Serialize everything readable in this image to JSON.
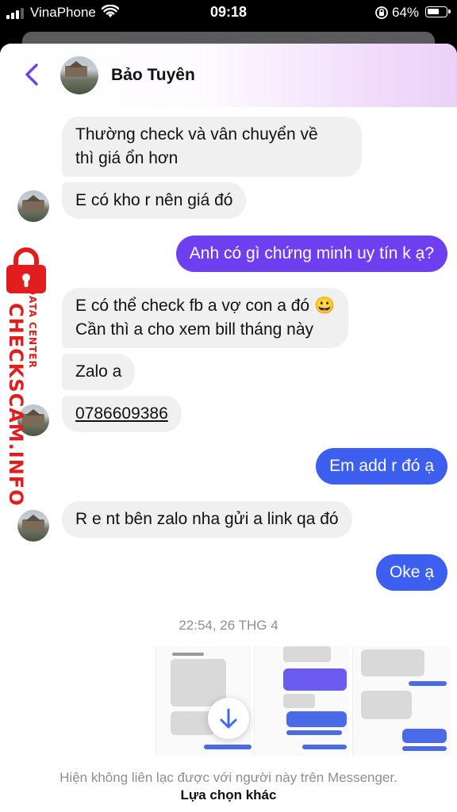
{
  "status_bar": {
    "carrier": "VinaPhone",
    "time": "09:18",
    "battery": "64%",
    "battery_level": 0.64
  },
  "header": {
    "contact_name": "Bảo Tuyên"
  },
  "messages": [
    {
      "direction": "in",
      "text_lines": [
        "Thường check và vân chuyển về",
        "thì giá ổn hơn"
      ]
    },
    {
      "direction": "in",
      "text": "E có kho r nên giá đó"
    },
    {
      "direction": "out",
      "text": "Anh có gì chứng minh uy tín k ạ?"
    },
    {
      "direction": "in",
      "text_lines": [
        "E có thể check fb a vợ con a đó 😀",
        "Cần thì a cho xem bill tháng này"
      ]
    },
    {
      "direction": "in",
      "text": "Zalo a"
    },
    {
      "direction": "in",
      "text": "0786609386",
      "link": true
    },
    {
      "direction": "out",
      "text": "Em add r đó ạ"
    },
    {
      "direction": "in",
      "text": "R e nt bên zalo nha gửi a link qa đó"
    },
    {
      "direction": "out",
      "text": "Oke ạ"
    }
  ],
  "timestamp": "22:54, 26 THG 4",
  "footer": {
    "note": "Hiện không liên lạc được với người này trên Messenger.",
    "action": "Lựa chọn khác"
  },
  "watermark": {
    "brand": "CHECKSCAM.INFO",
    "sub": "DATA CENTER"
  },
  "colors": {
    "accent": "#6e3ff0",
    "bubble_in": "#f0f0f0",
    "watermark": "#e21d1d"
  },
  "icons": [
    "back-chevron-icon",
    "scroll-down-icon",
    "wifi-icon",
    "signal-icon",
    "battery-icon",
    "orientation-lock-icon",
    "lock-icon"
  ]
}
